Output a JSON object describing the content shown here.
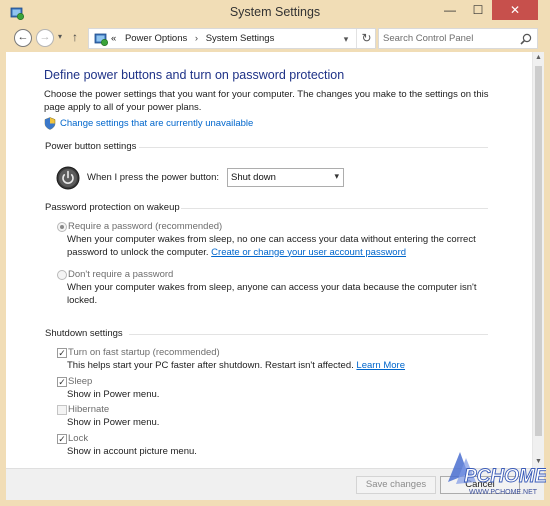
{
  "window": {
    "title": "System Settings",
    "minimize_glyph": "—",
    "maximize_glyph": "☐",
    "close_glyph": "✕"
  },
  "address": {
    "recent_glyph": "▾",
    "up_glyph": "↑",
    "back_glyph": "←",
    "forward_glyph": "→",
    "crumb_prefix": "«",
    "breadcrumbs": [
      "Power Options",
      "System Settings"
    ],
    "separator": "›",
    "dropdown_glyph": "▾",
    "refresh_glyph": "↻",
    "search_placeholder": "Search Control Panel"
  },
  "page": {
    "heading": "Define power buttons and turn on password protection",
    "intro": "Choose the power settings that you want for your computer. The changes you make to the settings on this page apply to all of your power plans.",
    "change_link": "Change settings that are currently unavailable"
  },
  "power_button": {
    "group_title": "Power button settings",
    "label": "When I press the power button:",
    "selected": "Shut down",
    "arrow": "▾"
  },
  "password": {
    "group_title": "Password protection on wakeup",
    "options": [
      {
        "label": "Require a password (recommended)",
        "checked": true,
        "desc": "When your computer wakes from sleep, no one can access your data without entering the correct password to unlock the computer.",
        "link": "Create or change your user account password"
      },
      {
        "label": "Don't require a password",
        "checked": false,
        "desc": "When your computer wakes from sleep, anyone can access your data because the computer isn't locked."
      }
    ]
  },
  "shutdown": {
    "group_title": "Shutdown settings",
    "items": [
      {
        "label": "Turn on fast startup (recommended)",
        "checked": true,
        "desc": "This helps start your PC faster after shutdown. Restart isn't affected.",
        "link": "Learn More"
      },
      {
        "label": "Sleep",
        "checked": true,
        "desc": "Show in Power menu."
      },
      {
        "label": "Hibernate",
        "checked": false,
        "desc": "Show in Power menu."
      },
      {
        "label": "Lock",
        "checked": true,
        "desc": "Show in account picture menu."
      }
    ]
  },
  "footer": {
    "save_label": "Save changes",
    "cancel_label": "Cancel"
  },
  "watermark": {
    "brand": "PCHOME",
    "site": "WWW.PCHOME.NET"
  },
  "scrollbar": {
    "up_glyph": "▲",
    "down_glyph": "▼"
  },
  "colors": {
    "title_frame": "#f1ddb6",
    "heading": "#1e3287",
    "link": "#0066cc",
    "close_button": "#c7504c"
  }
}
